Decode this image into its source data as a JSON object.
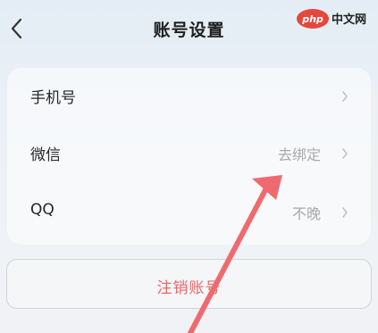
{
  "header": {
    "title": "账号设置",
    "back_icon": "chevron-left-icon"
  },
  "watermark": {
    "brand": "php",
    "site": "中文网"
  },
  "settings": {
    "rows": [
      {
        "label": "手机号",
        "value": ""
      },
      {
        "label": "微信",
        "value": "去绑定"
      },
      {
        "label": "QQ",
        "value": "不晚"
      }
    ]
  },
  "actions": {
    "cancel_account_label": "注销账号"
  },
  "colors": {
    "annotation_arrow": "#ef6a6f",
    "danger_text": "#e56a6a",
    "muted_text": "#a9a9a9"
  }
}
